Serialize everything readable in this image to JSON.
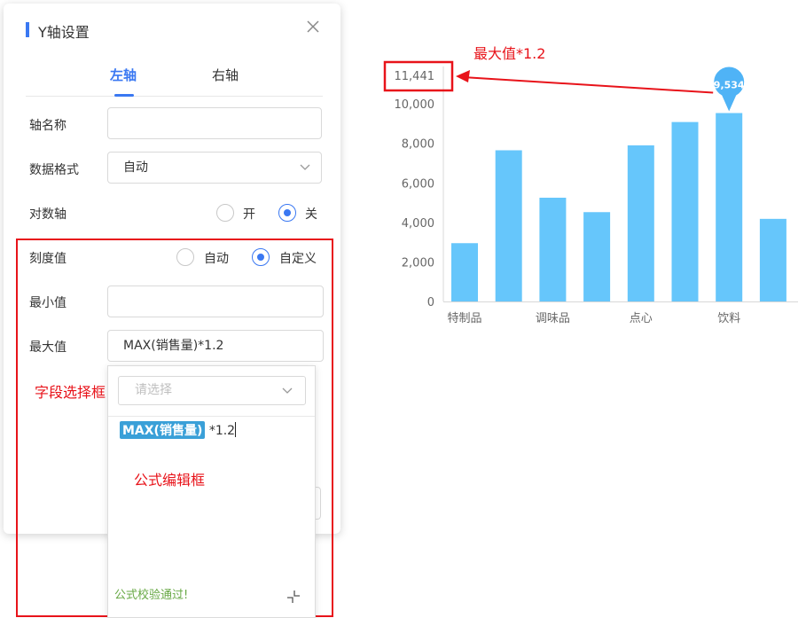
{
  "dialog": {
    "title": "Y轴设置",
    "tabs": [
      {
        "label": "左轴"
      },
      {
        "label": "右轴"
      }
    ],
    "rows": {
      "axis_name": {
        "label": "轴名称",
        "value": ""
      },
      "data_format": {
        "label": "数据格式",
        "value": "自动"
      },
      "log_axis": {
        "label": "对数轴",
        "options": [
          "开",
          "关"
        ],
        "selected": "关"
      },
      "tick_value": {
        "label": "刻度值",
        "options": [
          "自动",
          "自定义"
        ],
        "selected": "自定义"
      },
      "min_value": {
        "label": "最小值",
        "value": ""
      },
      "max_value": {
        "label": "最大值",
        "value": "MAX(销售量)*1.2"
      }
    }
  },
  "popup": {
    "field_select_placeholder": "请选择",
    "formula_field": "MAX(销售量)",
    "formula_rest": "*1.2",
    "validation_message": "公式校验通过!"
  },
  "annotations": {
    "field_select_box": "字段选择框",
    "formula_editor_box": "公式编辑框",
    "max_value_note": "最大值*1.2"
  },
  "chart_data": {
    "type": "bar",
    "categories": [
      "特制品",
      "",
      "调味品",
      "",
      "点心",
      "",
      "饮料",
      ""
    ],
    "values": [
      2950,
      7650,
      5250,
      4520,
      7900,
      9080,
      9534,
      4180
    ],
    "visible_category_labels": [
      "特制品",
      "调味品",
      "点心",
      "饮料"
    ],
    "y_ticks": [
      "0",
      "2,000",
      "4,000",
      "6,000",
      "8,000",
      "10,000",
      "11,441"
    ],
    "ylim": [
      0,
      11441
    ],
    "y_max_label": "11,441",
    "highlight": {
      "category_index": 6,
      "label": "9,534"
    },
    "bar_color": "#66c6fb",
    "grid": false
  },
  "colors": {
    "accent": "#3a78f2",
    "annotation_red": "#e8131a",
    "success": "#67a844",
    "chip": "#3aa0d8"
  }
}
